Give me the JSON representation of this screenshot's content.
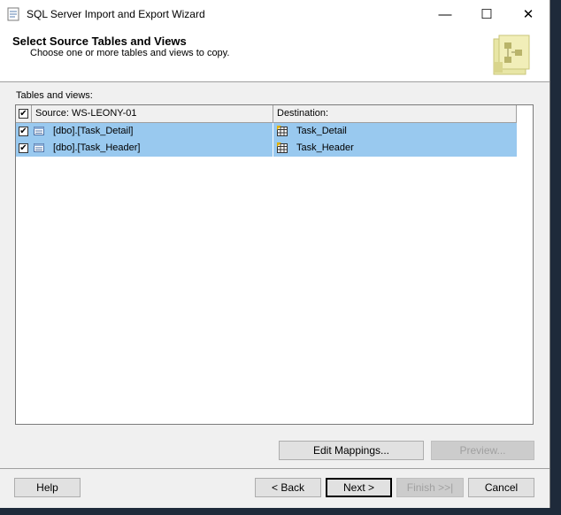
{
  "window": {
    "title": "SQL Server Import and Export Wizard",
    "minimize_glyph": "—",
    "maximize_glyph": "☐",
    "close_glyph": "✕"
  },
  "header": {
    "title": "Select Source Tables and Views",
    "subtitle": "Choose one or more tables and views to copy."
  },
  "tables": {
    "label": "Tables and views:",
    "header": {
      "all_checked": true,
      "source": "Source: WS-LEONY-01",
      "destination": "Destination:"
    },
    "rows": [
      {
        "checked": true,
        "source": "[dbo].[Task_Detail]",
        "destination": "Task_Detail"
      },
      {
        "checked": true,
        "source": "[dbo].[Task_Header]",
        "destination": "Task_Header"
      }
    ]
  },
  "buttons": {
    "edit_mappings": "Edit Mappings...",
    "preview": "Preview...",
    "help": "Help",
    "back": "< Back",
    "next": "Next >",
    "finish": "Finish >>|",
    "cancel": "Cancel"
  },
  "colors": {
    "selection": "#99c9ef",
    "window_bg": "#f0f0f0"
  }
}
